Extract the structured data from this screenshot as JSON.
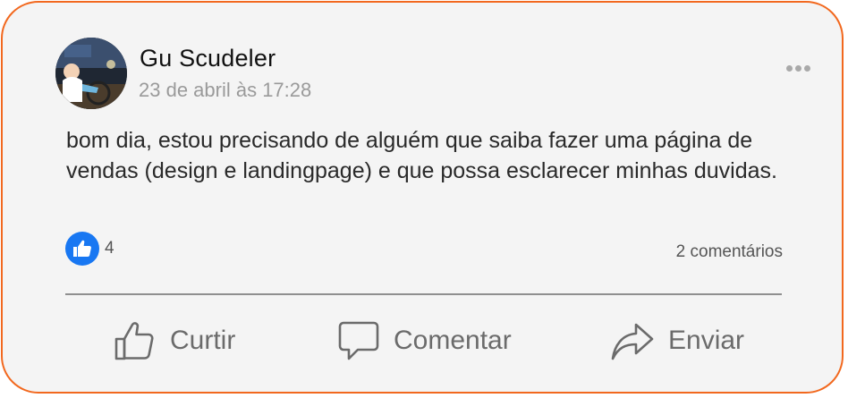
{
  "post": {
    "author": "Gu Scudeler",
    "timestamp": "23 de abril às 17:28",
    "text": "bom dia, estou precisando de alguém que saiba fazer uma página de vendas (design e landingpage) e que possa esclarecer minhas duvidas.",
    "like_count": "4",
    "comments_count": "2 comentários"
  },
  "actions": {
    "like": "Curtir",
    "comment": "Comentar",
    "share": "Enviar"
  },
  "icons": {
    "more": "more-horizontal-icon",
    "like_badge": "thumbs-up-icon",
    "like": "thumbs-up-outline-icon",
    "comment": "speech-bubble-icon",
    "share": "share-arrow-icon"
  },
  "colors": {
    "border": "#f2681e",
    "card_bg": "#f4f4f4",
    "like_blue": "#1877f2",
    "muted_text": "#6b6b6b"
  }
}
